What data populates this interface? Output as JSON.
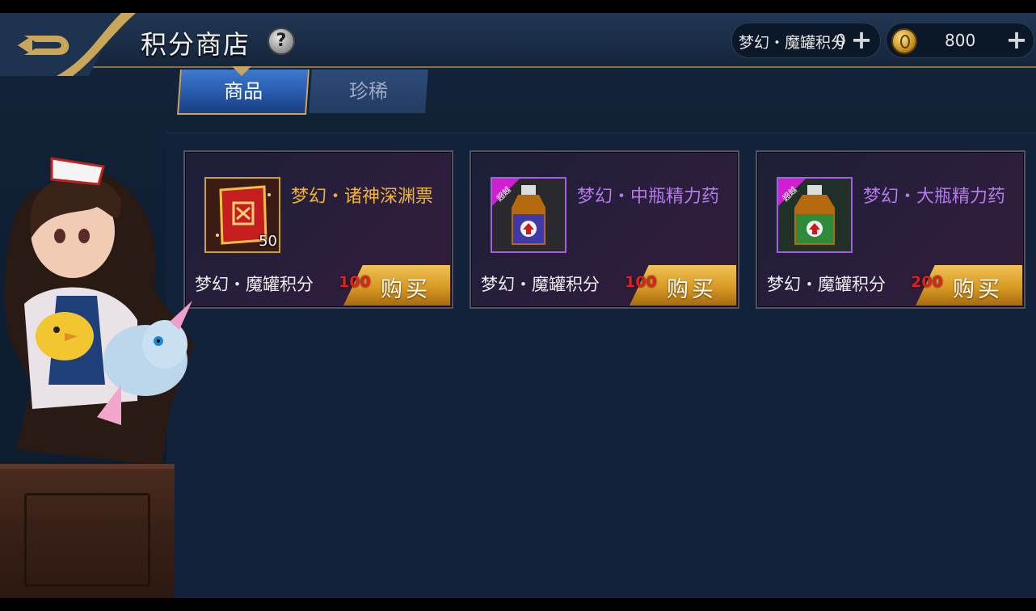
{
  "header": {
    "title": "积分商店",
    "help_symbol": "?"
  },
  "currencies": [
    {
      "label": "梦幻・魔罐积分",
      "value": "0",
      "plus": "+",
      "icon": "points-icon"
    },
    {
      "label": "",
      "value": "800",
      "plus": "+",
      "icon": "gold-coin-icon"
    }
  ],
  "tabs": [
    {
      "label": "商品",
      "active": true
    },
    {
      "label": "珍稀",
      "active": false
    }
  ],
  "items": [
    {
      "name": "梦幻・诸神深渊票",
      "count": "50",
      "badge": "",
      "price_label": "梦幻・魔罐积分",
      "price": "100",
      "buy_label": "购买",
      "rarity_color": "#f0b434",
      "icon": "ticket-scroll-icon"
    },
    {
      "name": "梦幻・中瓶精力药",
      "count": "",
      "badge": "超越",
      "price_label": "梦幻・魔罐积分",
      "price": "100",
      "buy_label": "购买",
      "rarity_color": "#b47ae8",
      "icon": "medium-potion-icon"
    },
    {
      "name": "梦幻・大瓶精力药",
      "count": "",
      "badge": "超越",
      "price_label": "梦幻・魔罐积分",
      "price": "200",
      "buy_label": "购买",
      "rarity_color": "#b47ae8",
      "icon": "large-potion-icon"
    }
  ],
  "colors": {
    "background": "#12223a",
    "accent_gold": "#c9a23a",
    "price_red": "#e32020"
  }
}
